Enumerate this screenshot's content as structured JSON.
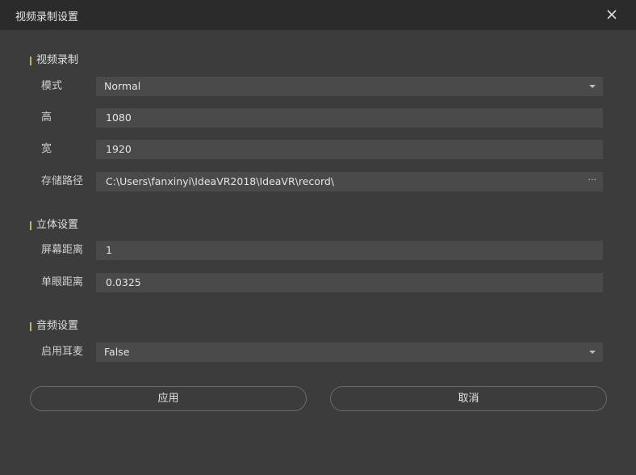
{
  "window": {
    "title": "视频录制设置"
  },
  "sections": {
    "video": {
      "title": "视频录制"
    },
    "stereo": {
      "title": "立体设置"
    },
    "audio": {
      "title": "音频设置"
    }
  },
  "fields": {
    "mode": {
      "label": "模式",
      "value": "Normal"
    },
    "height": {
      "label": "高",
      "value": "1080"
    },
    "width": {
      "label": "宽",
      "value": "1920"
    },
    "path": {
      "label": "存储路径",
      "value": "C:\\Users\\fanxinyi\\IdeaVR2018\\IdeaVR\\record\\",
      "browse": "···"
    },
    "screen_distance": {
      "label": "屏幕距离",
      "value": "1"
    },
    "eye_distance": {
      "label": "单眼距离",
      "value": "0.0325"
    },
    "headphones": {
      "label": "启用耳麦",
      "value": "False"
    }
  },
  "buttons": {
    "apply": "应用",
    "cancel": "取消"
  },
  "colors": {
    "background": "#3c3c3c",
    "titlebar": "#2b2b2b",
    "field": "#4a4a4a",
    "accent": "#c8b45a"
  },
  "icons": {
    "close": "close-icon",
    "dropdown": "chevron-down-icon"
  }
}
